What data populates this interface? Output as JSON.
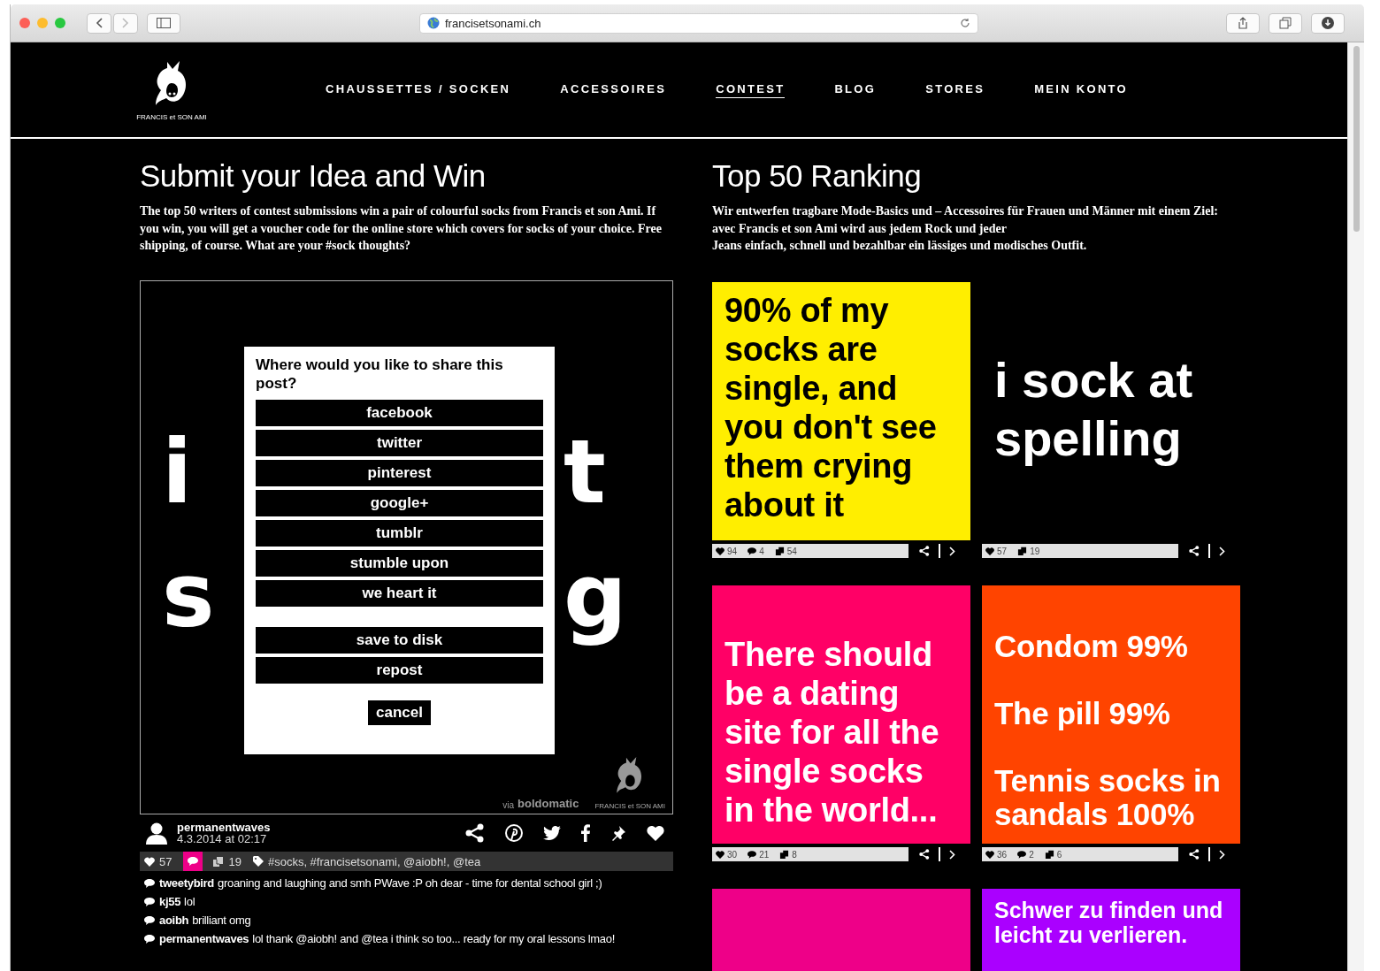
{
  "browser": {
    "url": "francisetsonami.ch"
  },
  "header": {
    "logo_text": "FRANCIS et SON AMI",
    "nav": [
      {
        "label": "CHAUSSETTES / SOCKEN",
        "selected": false
      },
      {
        "label": "ACCESSOIRES",
        "selected": false
      },
      {
        "label": "CONTEST",
        "selected": true
      },
      {
        "label": "BLOG",
        "selected": false
      },
      {
        "label": "STORES",
        "selected": false
      },
      {
        "label": "MEIN KONTO",
        "selected": false
      }
    ]
  },
  "contest": {
    "title": "Submit your Idea and Win",
    "description": "The top 50 writers of contest submissions win a pair of colourful socks from Francis et son Ami. If you win, you will get a voucher code for the online store which covers for socks of your choice. Free shipping, of course. What are your #sock thoughts?",
    "post": {
      "fragments": [
        {
          "left": "i",
          "right": "t"
        },
        {
          "left": "s",
          "right": "g"
        }
      ],
      "via": "via",
      "source": "boldomatic",
      "brand": "FRANCIS et SON AMI",
      "author": "permanentwaves",
      "date": "4.3.2014 at 02:17",
      "stats": {
        "likes": "57",
        "comments_open": true,
        "reposts": "19",
        "tags": "#socks, #francisetsonami, @aiobh!, @tea"
      },
      "comments": [
        {
          "user": "tweetybird",
          "text": "groaning and laughing and smh PWave :P oh dear - time for dental school girl ;)"
        },
        {
          "user": "kj55",
          "text": "lol"
        },
        {
          "user": "aoibh",
          "text": "brilliant omg"
        },
        {
          "user": "permanentwaves",
          "text": "lol thank @aiobh! and @tea i think so too... ready for my oral lessons lmao!"
        }
      ]
    },
    "share_dialog": {
      "title": "Where would you like to share this post?",
      "options": [
        "facebook",
        "twitter",
        "pinterest",
        "google+",
        "tumblr",
        "stumble upon",
        "we heart it"
      ],
      "actions": [
        "save to disk",
        "repost"
      ],
      "cancel": "cancel"
    }
  },
  "ranking": {
    "title": "Top 50 Ranking",
    "description": "Wir entwerfen tragbare Mode-Basics und – Accessoires für Frauen und Männer mit einem Ziel: avec Francis et son Ami wird aus jedem Rock und jeder\nJeans einfach, schnell und bezahlbar ein lässiges und modisches Outfit.",
    "tiles": [
      {
        "text": "90% of my socks are single, and you don't see them crying about it",
        "color": "#ffee00",
        "stats": [
          {
            "kind": "likes",
            "value": "94"
          },
          {
            "kind": "comments",
            "value": "4"
          },
          {
            "kind": "reposts",
            "value": "54"
          }
        ]
      },
      {
        "text": "i sock at spelling",
        "color": "#000000",
        "stats": [
          {
            "kind": "likes",
            "value": "57"
          },
          {
            "kind": "reposts",
            "value": "19"
          }
        ]
      },
      {
        "text": "There should be a dating site for all the single socks in the world...",
        "color": "#ff0066",
        "stats": [
          {
            "kind": "likes",
            "value": "30"
          },
          {
            "kind": "comments",
            "value": "21"
          },
          {
            "kind": "reposts",
            "value": "8"
          }
        ]
      },
      {
        "text": "Condom 99%\n\nThe pill 99%\n\nTennis socks in sandals 100%",
        "color": "#ff4400",
        "stats": [
          {
            "kind": "likes",
            "value": "36"
          },
          {
            "kind": "comments",
            "value": "2"
          },
          {
            "kind": "reposts",
            "value": "6"
          }
        ]
      },
      {
        "color": "#ee0088"
      },
      {
        "text": "Schwer zu finden und leicht zu verlieren.",
        "color": "#aa00ff"
      }
    ]
  }
}
